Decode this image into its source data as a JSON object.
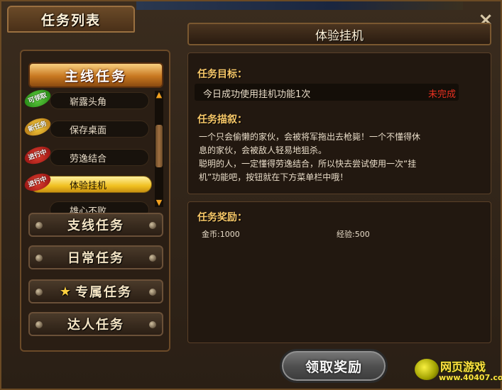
{
  "window": {
    "tab_title": "任务列表",
    "close_icon": "×"
  },
  "left": {
    "main_header": "主线任务",
    "tasks": [
      {
        "badge": "可领取",
        "badge_color": "green",
        "label": "崭露头角",
        "active": false
      },
      {
        "badge": "新任务",
        "badge_color": "yellow",
        "label": "保存桌面",
        "active": false
      },
      {
        "badge": "进行中",
        "badge_color": "red",
        "label": "劳逸结合",
        "active": false
      },
      {
        "badge": "进行中",
        "badge_color": "red",
        "label": "体验挂机",
        "active": true
      },
      {
        "badge": "",
        "badge_color": "red",
        "label": "雄心不败",
        "active": false
      }
    ],
    "categories": [
      "支线任务",
      "日常任务",
      "专属任务",
      "达人任务"
    ]
  },
  "right": {
    "header": "体验挂机",
    "goal_title": "任务目标：",
    "goal_text": "今日成功使用挂机功能1次",
    "goal_status": "未完成",
    "desc_title": "任务描叙：",
    "desc_lines": [
      "一个只会偷懒的家伙，会被将军拖出去枪毙！一个不懂得休",
      "息的家伙，会被敌人轻易地狙杀。",
      "聪明的人，一定懂得劳逸结合，所以快去尝试使用一次“挂",
      "机”功能吧，按钮就在下方菜单栏中哦！"
    ],
    "reward_title": "任务奖励：",
    "reward_gold": "金币:1000",
    "reward_exp": "经验:500"
  },
  "claim_button": "领取奖励",
  "watermark": {
    "text": "网页游戏",
    "url": "www.40407.com"
  },
  "colors": {
    "accent": "#f8c868",
    "status_incomplete": "#e83020",
    "active_task": "#f0c020"
  }
}
